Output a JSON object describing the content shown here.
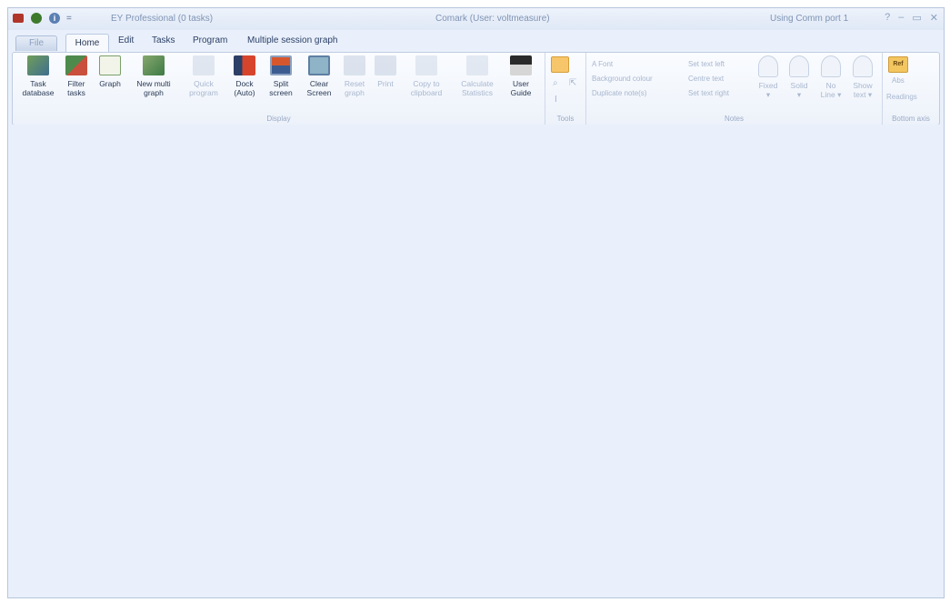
{
  "titlebar": {
    "app_title": "EY Professional (0 tasks)",
    "center_title": "Comark (User: voltmeasure)",
    "port_status": "Using Comm port 1",
    "qat_blue_glyph": "i",
    "qat_dropdown": "=",
    "controls": {
      "help": "?",
      "minimize": "–",
      "maximize": "▭",
      "close": "✕"
    }
  },
  "tabs": [
    {
      "label": "File"
    },
    {
      "label": "Home"
    },
    {
      "label": "Edit"
    },
    {
      "label": "Tasks"
    },
    {
      "label": "Program"
    },
    {
      "label": "Multiple session graph"
    }
  ],
  "ribbon": {
    "display": {
      "label": "Display",
      "buttons": [
        {
          "l1": "Task",
          "l2": "database"
        },
        {
          "l1": "Filter",
          "l2": "tasks"
        },
        {
          "l1": "Graph",
          "l2": ""
        },
        {
          "l1": "New multi",
          "l2": "graph"
        },
        {
          "l1": "Quick",
          "l2": "program"
        },
        {
          "l1": "Dock",
          "l2": "(Auto)"
        },
        {
          "l1": "Split",
          "l2": "screen"
        },
        {
          "l1": "Clear",
          "l2": "Screen"
        },
        {
          "l1": "Reset",
          "l2": "graph"
        },
        {
          "l1": "Print",
          "l2": ""
        },
        {
          "l1": "Copy to",
          "l2": "clipboard"
        },
        {
          "l1": "Calculate",
          "l2": "Statistics"
        },
        {
          "l1": "User",
          "l2": "Guide"
        }
      ]
    },
    "tools": {
      "label": "Tools"
    },
    "notes": {
      "label": "Notes",
      "items": [
        "A Font",
        "Background colour",
        "Duplicate note(s)",
        "Set text left",
        "Centre text",
        "Set text right"
      ],
      "buttons": [
        {
          "l1": "Fixed",
          "l2": "▾"
        },
        {
          "l1": "Solid",
          "l2": "▾"
        },
        {
          "l1": "No",
          "l2": "Line ▾"
        },
        {
          "l1": "Show",
          "l2": "text ▾"
        }
      ]
    },
    "bottom_axis": {
      "label": "Bottom axis",
      "icon_text": "Ref",
      "l1": "Abs",
      "l2": "Readings"
    }
  }
}
